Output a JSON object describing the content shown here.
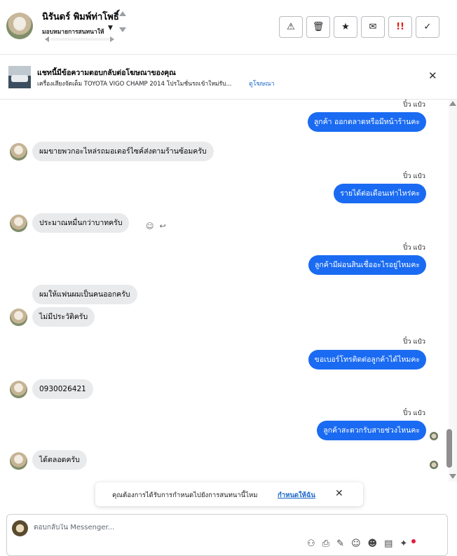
{
  "header": {
    "contact_name": "นิรันดร์ พิมพ์ท่าโพธิ์",
    "assign_label": "มอบหมายการสนทนาให้",
    "actions": [
      {
        "name": "report-button",
        "icon": "warning-icon",
        "glyph": "⚠"
      },
      {
        "name": "delete-button",
        "icon": "trash-icon",
        "glyph": "🗑"
      },
      {
        "name": "star-button",
        "icon": "star-icon",
        "glyph": "★"
      },
      {
        "name": "mark-unread-button",
        "icon": "envelope-open-icon",
        "glyph": "✉"
      },
      {
        "name": "follow-up-button",
        "icon": "exclamation-icon",
        "glyph": "!!"
      },
      {
        "name": "mark-done-button",
        "icon": "check-icon",
        "glyph": "✓"
      }
    ]
  },
  "ad_banner": {
    "title": "แชทนี้มีข้อความตอบกลับต่อโฆษณาของคุณ",
    "description": "เครื่องเสียงจัดเต็ม TOYOTA VIGO CHAMP 2014 โปรโมชั่นรถเข้าใหม่รับ...",
    "link": "ดูโฆษณา"
  },
  "messages": {
    "m1": {
      "sender": "ปิ๋ว แป๋ว",
      "text": "ลูกค้า  ออกตลาดหรือมีหน้าร้านคะ"
    },
    "m2": {
      "text": "ผมขายพวกอะไหล่รถมอเตอร์ไซค์ส่งตามร้านซ้อมครับ"
    },
    "m3": {
      "sender": "ปิ๋ว แป๋ว",
      "text": "รายได้ต่อเดือนเท่าไหร่คะ"
    },
    "m4": {
      "text": "ประมาณหมื่นกว่าบาทครับ"
    },
    "m5": {
      "sender": "ปิ๋ว แป๋ว",
      "text": "ลูกค้ามีผ่อนสินเชื่ออะไรอยู่ไหมคะ"
    },
    "m6": {
      "text": "ผมให้แฟนผมเป็นคนออกครับ"
    },
    "m7": {
      "text": "ไม่มีประวัติครับ"
    },
    "m8": {
      "sender": "ปิ๋ว แป๋ว",
      "text": "ขอเบอร์โทรติดต่อลูกค้าได้ไหมคะ"
    },
    "m9": {
      "text": "0930026421"
    },
    "m10": {
      "sender": "ปิ๋ว แป๋ว",
      "text": "ลูกค้าสะดวกรับสายช่วงไหนคะ"
    },
    "m11": {
      "text": "ได้ตลอดครับ"
    }
  },
  "toast": {
    "text": "คุณต้องการได้รับการกำหนดไปยังการสนทนานี้ไหม",
    "link": "กำหนดให้ฉัน"
  },
  "composer": {
    "placeholder": "ตอบกลับใน Messenger..."
  }
}
